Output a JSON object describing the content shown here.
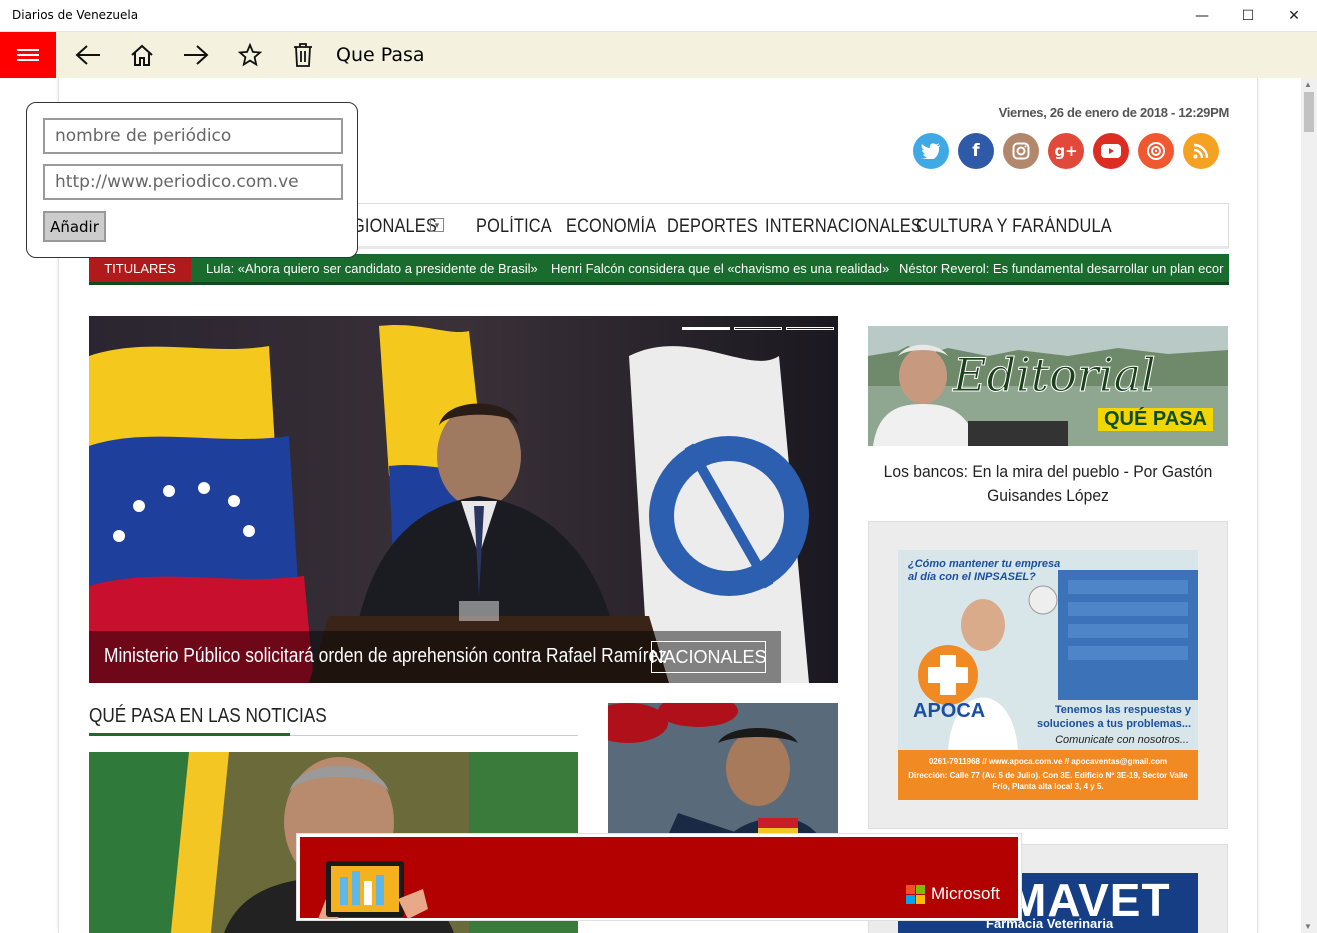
{
  "window": {
    "title": "Diarios de Venezuela",
    "minimize": "—",
    "maximize": "☐",
    "close": "✕"
  },
  "appbar": {
    "page_title": "Que Pasa"
  },
  "popup": {
    "name_placeholder": "nombre de periódico",
    "url_placeholder": "http://www.periodico.com.ve",
    "add_label": "Añadir"
  },
  "site": {
    "date": "Viernes, 26 de enero de 2018 - 12:29PM",
    "menu": [
      "GIONALES",
      "POLÍTICA",
      "ECONOMÍA",
      "DEPORTES",
      "INTERNACIONALES",
      "CULTURA Y FARÁNDULA"
    ],
    "ticker_label": "TITULARES",
    "ticker_items": [
      "Lula: «Ahora quiero ser candidato a presidente de Brasil»",
      "Henri Falcón considera que el «chavismo es una realidad»",
      "Néstor Reverol: Es fundamental desarrollar un plan ecor"
    ],
    "hero": {
      "headline": "Ministerio Público solicitará orden de aprehensión contra Rafael Ramírez",
      "tag": "NACIONALES"
    },
    "editorial": {
      "banner_text": "Editorial",
      "brand": "QUÉ PASA",
      "caption": "Los bancos: En la mira del pueblo - Por Gastón Guisandes López"
    },
    "ad_apoca": {
      "headline": "¿Cómo mantener tu empresa al día con el INPSASEL?",
      "brand": "APOCA",
      "tagline": "Tenemos las respuestas y soluciones a tus problemas...",
      "cta": "Comunicate con nosotros...",
      "contact": "0261-7911968 // www.apoca.com.ve // apocaventas@gmail.com",
      "address": "Dirección: Calle 77 (Av. 5 de Julio). Con 3E. Edificio Nº 3E-19, Sector Valle Frío, Planta alta local 3, 4 y 5."
    },
    "ad_mavet": {
      "brand": "MAVET",
      "sub": "Farmacia Veterinaria"
    },
    "section_title": "QUÉ PASA EN LAS NOTICIAS"
  },
  "banner": {
    "brand": "Microsoft"
  },
  "colors": {
    "accent_red": "#ff0000",
    "appbar_bg": "#f4f2de",
    "ticker_green": "#1a6b2e",
    "ticker_label_red": "#b01a1a",
    "banner_red": "#b30000"
  }
}
